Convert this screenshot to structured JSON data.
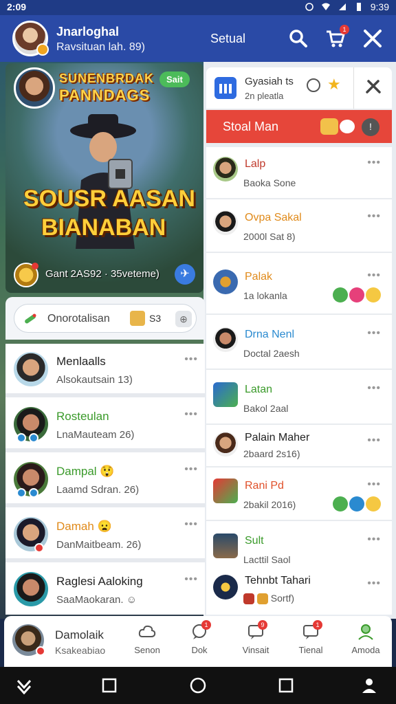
{
  "status": {
    "time": "2:09",
    "clock": "9:39"
  },
  "header": {
    "name": "Jnarloghal",
    "subtitle": "Ravsituan lah. 89)",
    "center_label": "Setual",
    "cart_badge": "1"
  },
  "banner": {
    "title_line1": "SUNENBRDAK",
    "title_line2": "PANNDAGS",
    "pill": "Sait",
    "big_line1": "SOUSR AASAN",
    "big_line2": "BIANABAN",
    "footer_text": "Gant 2AS92 · 35veteme)"
  },
  "search": {
    "value": "Onorotalisan",
    "count": "S3"
  },
  "left_list": [
    {
      "title": "Menlaalls",
      "subtitle": "Alsokautsain 13)",
      "title_color": "#222",
      "emoji": ""
    },
    {
      "title": "Rosteulan",
      "subtitle": "LnaMauteam 26)",
      "title_color": "#3a9a2a",
      "emoji": ""
    },
    {
      "title": "Dampal",
      "subtitle": "Laamd Sdran. 26)",
      "title_color": "#3a9a2a",
      "emoji": "😲"
    },
    {
      "title": "Damah",
      "subtitle": "DanMaitbeam. 26)",
      "title_color": "#e08a1a",
      "emoji": "😦"
    },
    {
      "title": "Raglesi Aaloking",
      "subtitle": "SaaMaokaran.",
      "title_color": "#222",
      "emoji": ""
    }
  ],
  "right_top": {
    "line1": "Gyasiah ts",
    "line2": "2n pleatla"
  },
  "right_bar": {
    "label": "Stoal Man"
  },
  "right_list": [
    {
      "title": "Lalp",
      "subtitle": "Baoka Sone",
      "title_color": "#c0392b"
    },
    {
      "title": "Ovpa Sakal",
      "subtitle": "2000l Sat 8)",
      "title_color": "#e08a1a"
    },
    {
      "title": "Palak",
      "subtitle": "1a lokanla",
      "title_color": "#e08a1a"
    },
    {
      "title": "Drna Nenl",
      "subtitle": "Doctal 2aesh",
      "title_color": "#2a8ad0"
    },
    {
      "title": "Latan",
      "subtitle": "Bakol 2aal",
      "title_color": "#3a9a2a"
    },
    {
      "title": "Palain Maher",
      "subtitle": "2baard 2s16)",
      "title_color": "#222"
    },
    {
      "title": "Rani Pd",
      "subtitle": "2bakil 2016)",
      "title_color": "#e0502a"
    },
    {
      "title": "Sult",
      "subtitle": "Lacttil Saol",
      "title_color": "#3a9a2a"
    },
    {
      "title": "Tehnbt Tahari",
      "subtitle": "Sortf)",
      "title_color": "#222"
    }
  ],
  "bottom_nav": {
    "me_name": "Damolaik",
    "me_sub": "Ksakeabiao",
    "tabs": [
      {
        "label": "Senon",
        "badge": ""
      },
      {
        "label": "Dok",
        "badge": "1"
      },
      {
        "label": "Vinsait",
        "badge": "9"
      },
      {
        "label": "Tienal",
        "badge": "1"
      },
      {
        "label": "Amoda",
        "badge": ""
      }
    ]
  },
  "colors": {
    "header_bg": "#2a4aa6",
    "accent_red": "#e6463a",
    "accent_green": "#4cbb5a"
  }
}
